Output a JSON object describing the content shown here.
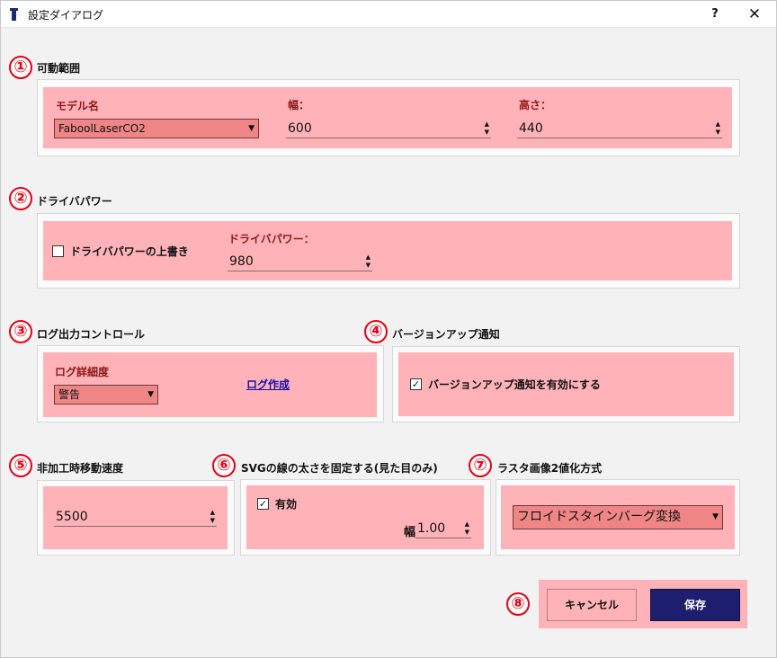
{
  "window": {
    "title": "設定ダイアログ",
    "help_label": "?",
    "close_label": "✕"
  },
  "colors": {
    "highlight": "#ffb3b8",
    "marker": "#e60012",
    "save": "#1e1e6e"
  },
  "sections": {
    "range": {
      "number": "①",
      "title": "可動範囲",
      "model_label": "モデル名",
      "model_value": "FaboolLaserCO2",
      "width_label": "幅：",
      "width_value": "600",
      "height_label": "高さ：",
      "height_value": "440"
    },
    "driver_power": {
      "number": "②",
      "title": "ドライバパワー",
      "override_label": "ドライバパワーの上書き",
      "power_label": "ドライバパワー：",
      "power_value": "980",
      "override_checked": false
    },
    "log": {
      "number": "③",
      "title": "ログ出力コントロール",
      "detail_label": "ログ詳細度",
      "detail_value": "警告",
      "create_link": "ログ作成"
    },
    "version": {
      "number": "④",
      "title": "バージョンアップ通知",
      "enable_label": "バージョンアップ通知を有効にする",
      "enable_checked": true
    },
    "speed": {
      "number": "⑤",
      "title": "非加工時移動速度",
      "value": "5500"
    },
    "svg": {
      "number": "⑥",
      "title": "SVGの線の太さを固定する(見た目のみ)",
      "enable_label": "有効",
      "enable_checked": true,
      "width_label": "幅",
      "width_value": "1.00"
    },
    "raster": {
      "number": "⑦",
      "title": "ラスタ画像2値化方式",
      "method_value": "フロイドスタインバーグ変換"
    }
  },
  "footer": {
    "number": "⑧",
    "cancel_label": "キャンセル",
    "save_label": "保存"
  },
  "icons": {
    "check": "✓",
    "dropdown": "▼",
    "spin_up": "▲",
    "spin_down": "▼"
  }
}
